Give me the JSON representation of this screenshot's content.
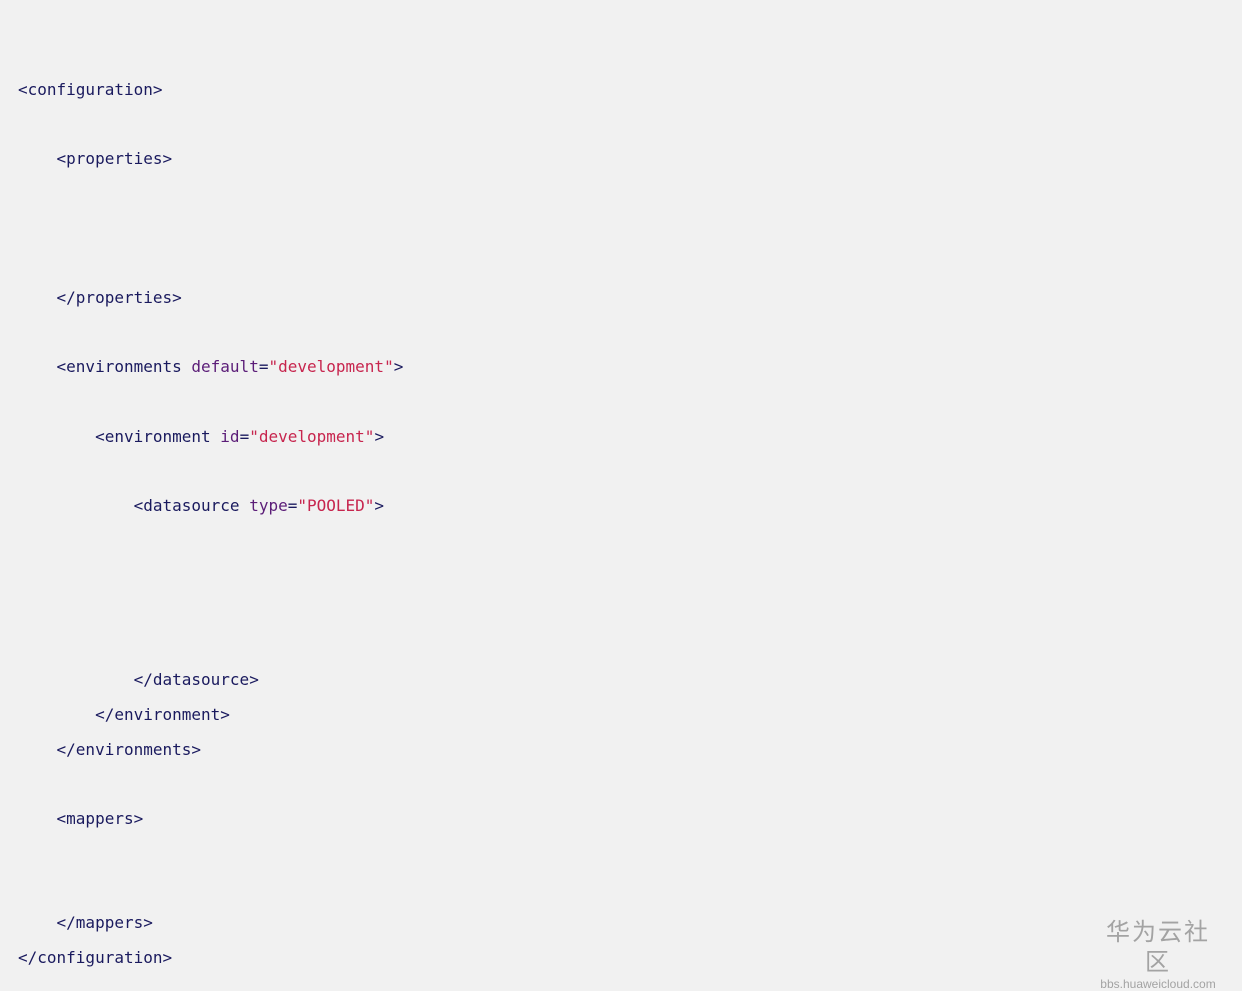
{
  "code": {
    "lines": [
      {
        "indent": "",
        "tokens": [
          {
            "t": "tag",
            "v": "<configuration>"
          }
        ]
      },
      {
        "indent": "    ",
        "tokens": [
          {
            "t": "tag",
            "v": "<properties>"
          }
        ]
      },
      {
        "indent": "    ",
        "tokens": [
          {
            "t": "tag",
            "v": "</properties>"
          }
        ]
      },
      {
        "indent": "    ",
        "tokens": [
          {
            "t": "tag",
            "v": "<environments "
          },
          {
            "t": "attr",
            "v": "default"
          },
          {
            "t": "tag",
            "v": "="
          },
          {
            "t": "val",
            "v": "\"development\""
          },
          {
            "t": "tag",
            "v": ">"
          }
        ]
      },
      {
        "indent": "        ",
        "tokens": [
          {
            "t": "tag",
            "v": "<environment "
          },
          {
            "t": "attr",
            "v": "id"
          },
          {
            "t": "tag",
            "v": "="
          },
          {
            "t": "val",
            "v": "\"development\""
          },
          {
            "t": "tag",
            "v": ">"
          }
        ]
      },
      {
        "indent": "            ",
        "tokens": [
          {
            "t": "tag",
            "v": "<datasource "
          },
          {
            "t": "attr",
            "v": "type"
          },
          {
            "t": "tag",
            "v": "="
          },
          {
            "t": "val",
            "v": "\"POOLED\""
          },
          {
            "t": "tag",
            "v": ">"
          }
        ]
      },
      {
        "indent": "            ",
        "tokens": [
          {
            "t": "tag",
            "v": "</datasource>"
          }
        ]
      },
      {
        "indent": "        ",
        "tokens": [
          {
            "t": "tag",
            "v": "</environment>"
          }
        ]
      },
      {
        "indent": "    ",
        "tokens": [
          {
            "t": "tag",
            "v": "</environments>"
          }
        ]
      },
      {
        "indent": "    ",
        "tokens": [
          {
            "t": "tag",
            "v": "<mappers>"
          }
        ]
      },
      {
        "indent": "    ",
        "tokens": [
          {
            "t": "tag",
            "v": "</mappers>"
          }
        ]
      },
      {
        "indent": "",
        "tokens": [
          {
            "t": "tag",
            "v": "</configuration>"
          }
        ]
      }
    ]
  },
  "watermark": {
    "title": "华为云社区",
    "url": "bbs.huaweicloud.com"
  },
  "colors": {
    "background": "#f1f1f1",
    "tag": "#1a1a5e",
    "attribute": "#5b1d78",
    "value": "#c7254e",
    "watermark": "#a3a3a3"
  }
}
